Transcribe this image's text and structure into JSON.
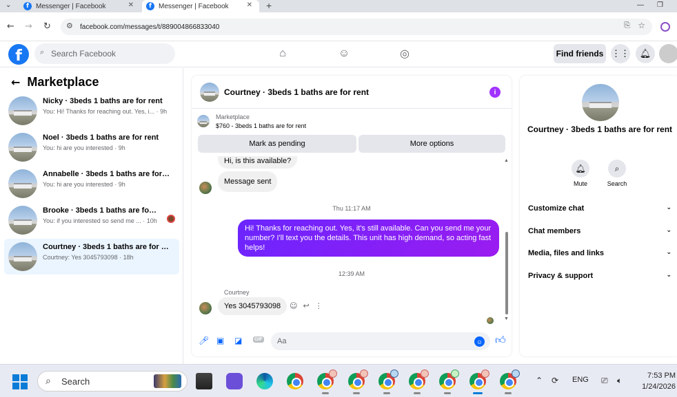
{
  "browser": {
    "tabs": [
      {
        "title": "Messenger | Facebook"
      },
      {
        "title": "Messenger | Facebook"
      }
    ],
    "url": "facebook.com/messages/t/889004866833040"
  },
  "fb_header": {
    "search_placeholder": "Search Facebook",
    "find_friends": "Find friends"
  },
  "sidebar": {
    "title": "Marketplace",
    "conversations": [
      {
        "name": "Nicky · 3beds 1 baths are for rent",
        "snippet": "You: Hi! Thanks for reaching out. Yes, i...",
        "time": "· 9h"
      },
      {
        "name": "Noel · 3beds 1 baths are for rent",
        "snippet": "You: hi are you interested",
        "time": "· 9h"
      },
      {
        "name": "Annabelle · 3beds 1 baths are for r...",
        "snippet": "You: hi are you interested",
        "time": "· 9h"
      },
      {
        "name": "Brooke · 3beds 1 baths are for re...",
        "snippet": "You: if you interested so send me ...",
        "time": "· 10h"
      },
      {
        "name": "Courtney · 3beds 1 baths are for rent",
        "snippet": "Courtney: Yes 3045793098",
        "time": "· 18h"
      }
    ]
  },
  "chat": {
    "title": "Courtney · 3beds 1 baths are for rent",
    "info_icon": "i",
    "marketplace": {
      "label": "Marketplace",
      "listing": "$760 - 3beds 1 baths are for rent",
      "mark_pending": "Mark as pending",
      "more_options": "More options"
    },
    "messages": {
      "partial_in": "Hi, is this available?",
      "sent_notice": "Message sent",
      "timestamp1": "Thu 11:17 AM",
      "out_message": "Hi! Thanks for reaching out. Yes, it's still available. Can you send me your number? I'll text you the details. This unit has high demand, so acting fast helps!",
      "timestamp2": "12:39 AM",
      "sender": "Courtney",
      "reply": "Yes 3045793098"
    },
    "composer_placeholder": "Aa",
    "composer_gif": "GIF"
  },
  "right_panel": {
    "name": "Courtney · 3beds 1 baths are for rent",
    "actions": [
      {
        "label": "Mute",
        "icon": "bell-icon"
      },
      {
        "label": "Search",
        "icon": "search-icon"
      }
    ],
    "sections": [
      "Customize chat",
      "Chat members",
      "Media, files and links",
      "Privacy & support"
    ]
  },
  "taskbar": {
    "search": "Search",
    "lang": "ENG",
    "time": "7:53 PM",
    "date": "1/24/2026"
  },
  "colors": {
    "fb_blue": "#1877f2",
    "messenger_purple": "#7f1af7",
    "active_conv_bg": "#ebf5ff"
  }
}
